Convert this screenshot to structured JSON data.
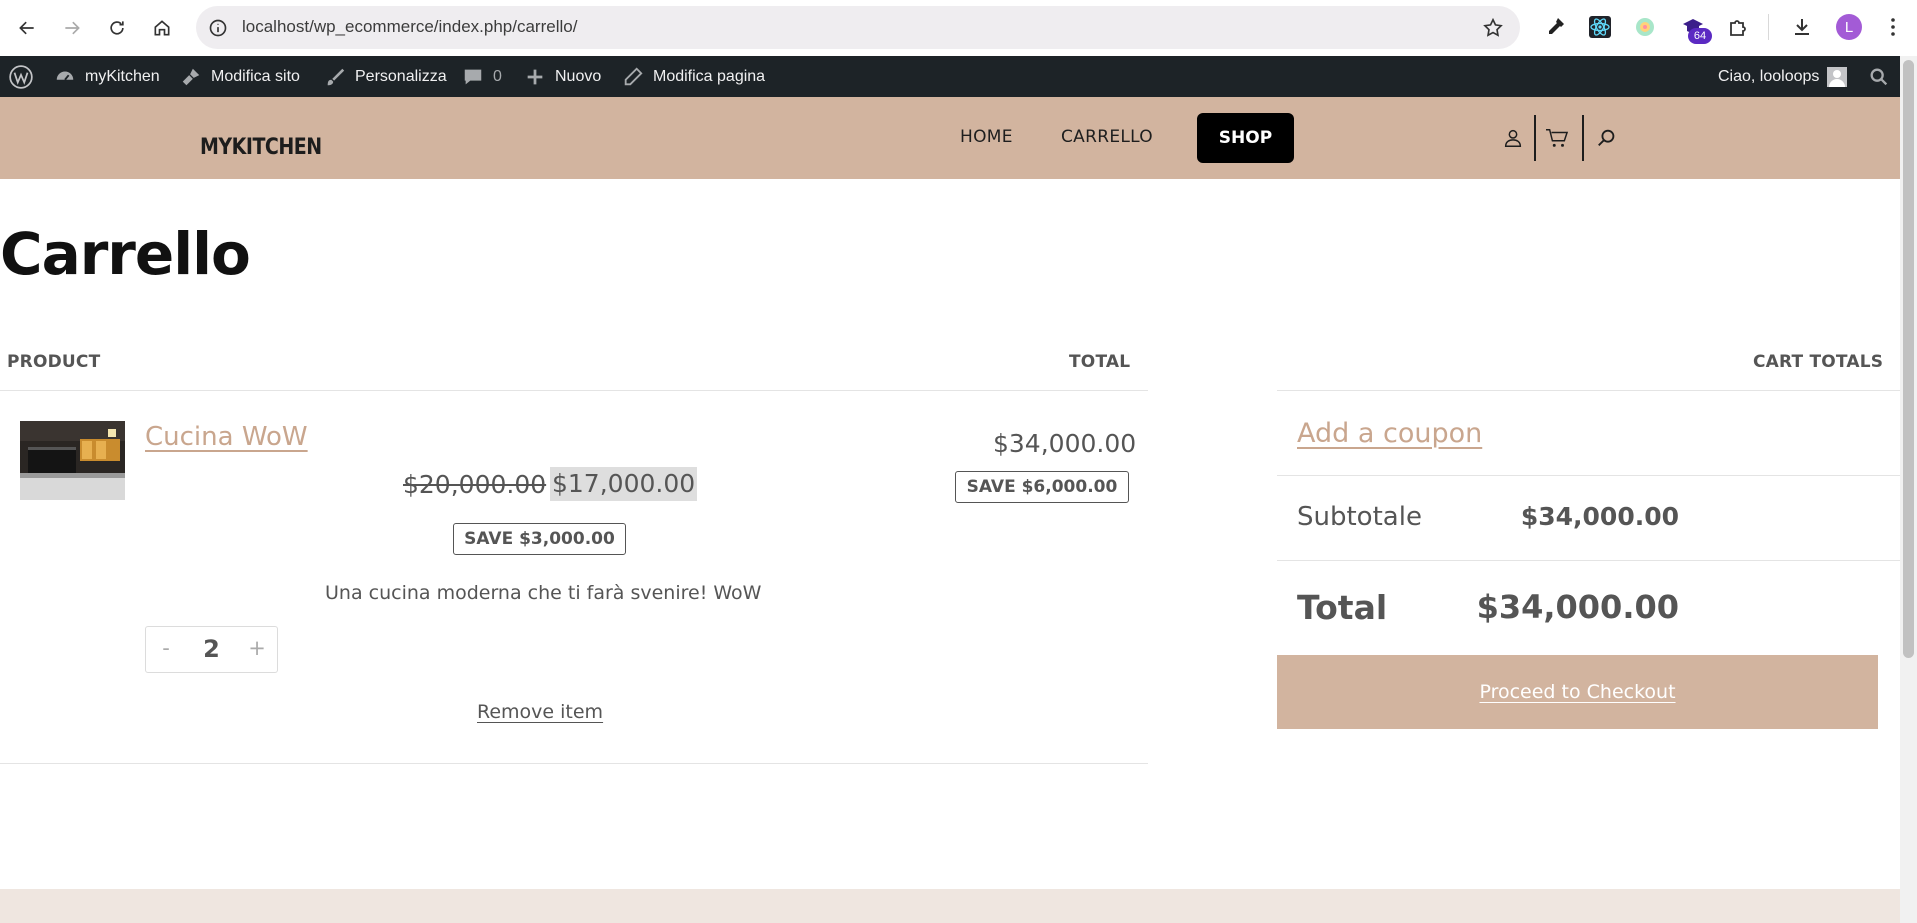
{
  "browser": {
    "url": "localhost/wp_ecommerce/index.php/carrello/",
    "extension_badge": "64",
    "profile_initial": "L"
  },
  "adminbar": {
    "site_name": "myKitchen",
    "edit_site": "Modifica sito",
    "customize": "Personalizza",
    "comments_count": "0",
    "new": "Nuovo",
    "edit_page": "Modifica pagina",
    "greeting": "Ciao, looloops"
  },
  "header": {
    "logo": "MYKITCHEN",
    "menu": {
      "home": "HOME",
      "cart": "CARRELLO",
      "shop": "SHOP"
    }
  },
  "page": {
    "title": "Carrello"
  },
  "cart_table": {
    "col_product": "PRODUCT",
    "col_total": "TOTAL",
    "item": {
      "name": "Cucina WoW",
      "regular_price": "$20,000.00",
      "sale_price": "$17,000.00",
      "item_save": "SAVE $3,000.00",
      "description": "Una cucina moderna che ti farà svenire! WoW",
      "qty_minus": "-",
      "qty_value": "2",
      "qty_plus": "+",
      "remove": "Remove item",
      "line_total": "$34,000.00",
      "line_save": "SAVE $6,000.00"
    }
  },
  "totals": {
    "heading": "CART TOTALS",
    "coupon": "Add a coupon",
    "subtotal_label": "Subtotale",
    "subtotal_value": "$34,000.00",
    "total_label": "Total",
    "total_value": "$34,000.00",
    "checkout": "Proceed to Checkout"
  },
  "colors": {
    "accent": "#d2b49f",
    "adminbar": "#1d2327",
    "text": "#555555"
  }
}
